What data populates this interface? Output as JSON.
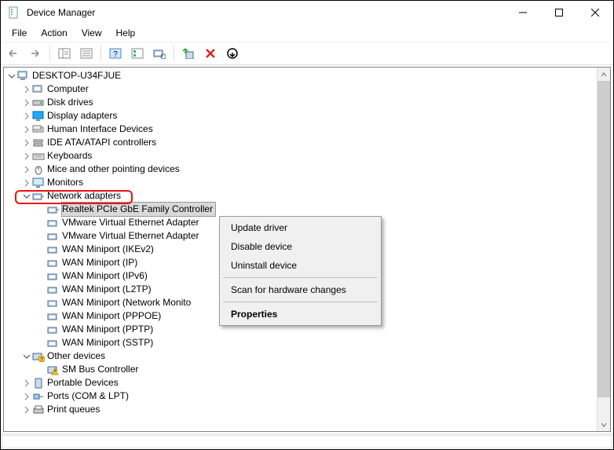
{
  "window": {
    "title": "Device Manager"
  },
  "menubar": {
    "file": "File",
    "action": "Action",
    "view": "View",
    "help": "Help"
  },
  "tree": {
    "root": "DESKTOP-U34FJUE",
    "nodes": [
      {
        "label": "Computer"
      },
      {
        "label": "Disk drives"
      },
      {
        "label": "Display adapters"
      },
      {
        "label": "Human Interface Devices"
      },
      {
        "label": "IDE ATA/ATAPI controllers"
      },
      {
        "label": "Keyboards"
      },
      {
        "label": "Mice and other pointing devices"
      },
      {
        "label": "Monitors"
      },
      {
        "label": "Network adapters",
        "expanded": true
      },
      {
        "label": "Other devices",
        "expanded": true
      },
      {
        "label": "Portable Devices"
      },
      {
        "label": "Ports (COM & LPT)"
      },
      {
        "label": "Print queues"
      }
    ],
    "network_children": [
      {
        "label": "Realtek PCIe GbE Family Controller"
      },
      {
        "label": "VMware Virtual Ethernet Adapter"
      },
      {
        "label": "VMware Virtual Ethernet Adapter"
      },
      {
        "label": "WAN Miniport (IKEv2)"
      },
      {
        "label": "WAN Miniport (IP)"
      },
      {
        "label": "WAN Miniport (IPv6)"
      },
      {
        "label": "WAN Miniport (L2TP)"
      },
      {
        "label": "WAN Miniport (Network Monito"
      },
      {
        "label": "WAN Miniport (PPPOE)"
      },
      {
        "label": "WAN Miniport (PPTP)"
      },
      {
        "label": "WAN Miniport (SSTP)"
      }
    ],
    "other_children": [
      {
        "label": "SM Bus Controller"
      }
    ]
  },
  "context_menu": {
    "update": "Update driver",
    "disable": "Disable device",
    "uninstall": "Uninstall device",
    "scan": "Scan for hardware changes",
    "properties": "Properties"
  }
}
